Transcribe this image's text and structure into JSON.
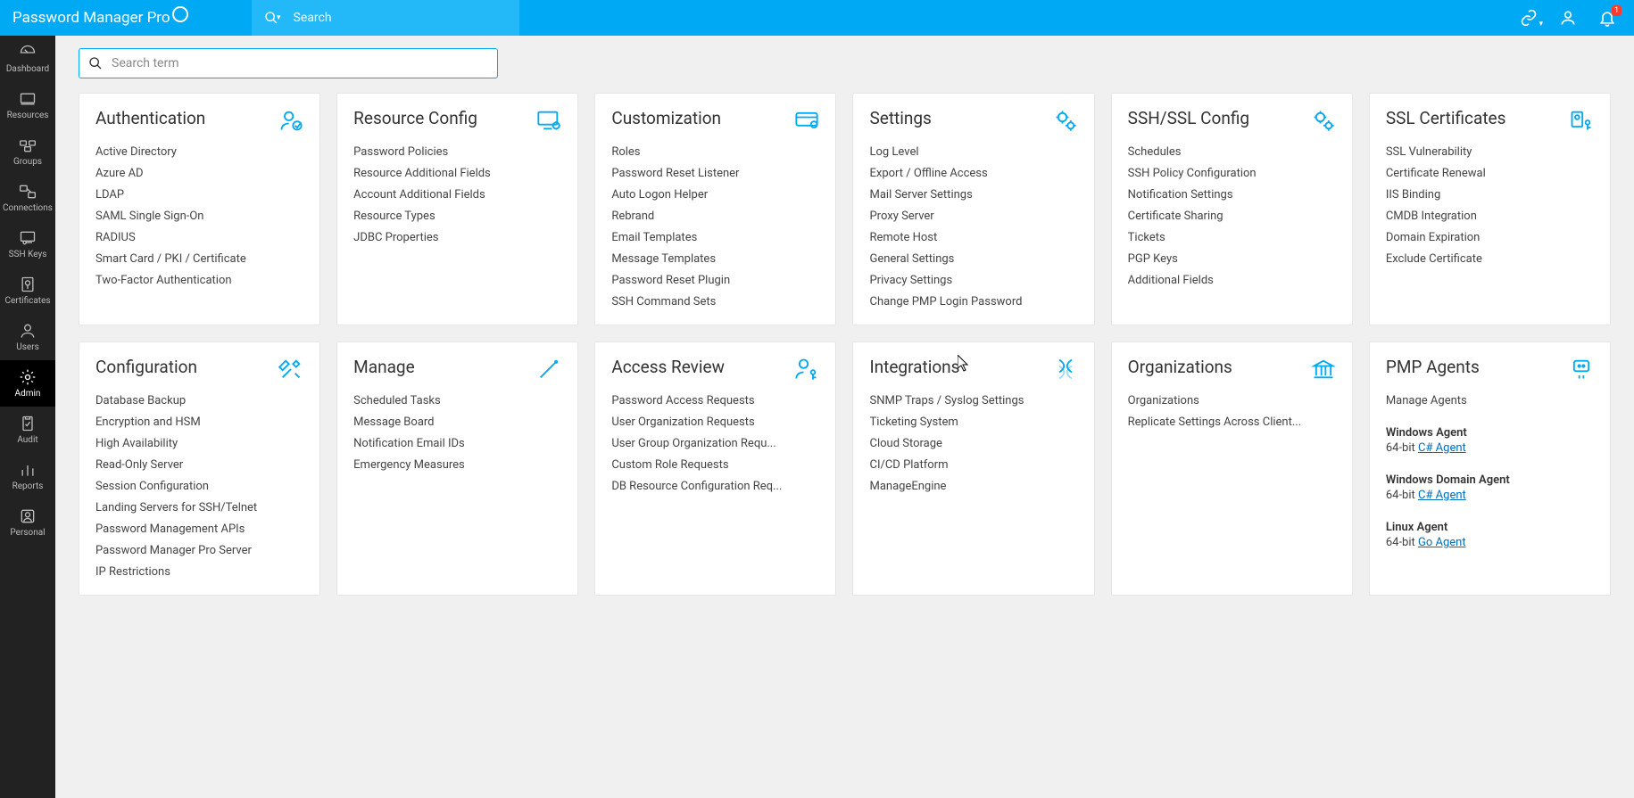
{
  "brand": "Password Manager Pro",
  "topsearch_placeholder": "Search",
  "filter_placeholder": "Search term",
  "notif_badge": "1",
  "sidebar": [
    {
      "id": "dashboard",
      "label": "Dashboard"
    },
    {
      "id": "resources",
      "label": "Resources"
    },
    {
      "id": "groups",
      "label": "Groups"
    },
    {
      "id": "connections",
      "label": "Connections"
    },
    {
      "id": "ssh-keys",
      "label": "SSH Keys"
    },
    {
      "id": "certificates",
      "label": "Certificates"
    },
    {
      "id": "users",
      "label": "Users"
    },
    {
      "id": "admin",
      "label": "Admin",
      "active": true
    },
    {
      "id": "audit",
      "label": "Audit"
    },
    {
      "id": "reports",
      "label": "Reports"
    },
    {
      "id": "personal",
      "label": "Personal"
    }
  ],
  "cards": [
    {
      "id": "authentication",
      "title": "Authentication",
      "icon": "user-check",
      "items": [
        "Active Directory",
        "Azure AD",
        "LDAP",
        "SAML Single Sign-On",
        "RADIUS",
        "Smart Card / PKI / Certificate",
        "Two-Factor Authentication"
      ]
    },
    {
      "id": "resource-config",
      "title": "Resource Config",
      "icon": "monitor-gear",
      "items": [
        "Password Policies",
        "Resource Additional Fields",
        "Account Additional Fields",
        "Resource Types",
        "JDBC Properties"
      ]
    },
    {
      "id": "customization",
      "title": "Customization",
      "icon": "card-gear",
      "items": [
        "Roles",
        "Password Reset Listener",
        "Auto Logon Helper",
        "Rebrand",
        "Email Templates",
        "Message Templates",
        "Password Reset Plugin",
        "SSH Command Sets"
      ]
    },
    {
      "id": "settings",
      "title": "Settings",
      "icon": "gears",
      "items": [
        "Log Level",
        "Export / Offline Access",
        "Mail Server Settings",
        "Proxy Server",
        "Remote Host",
        "General Settings",
        "Privacy Settings",
        "Change PMP Login Password"
      ]
    },
    {
      "id": "ssh-ssl-config",
      "title": "SSH/SSL Config",
      "icon": "gears",
      "items": [
        "Schedules",
        "SSH Policy Configuration",
        "Notification Settings",
        "Certificate Sharing",
        "Tickets",
        "PGP Keys",
        "Additional Fields"
      ]
    },
    {
      "id": "ssl-certificates",
      "title": "SSL Certificates",
      "icon": "cert-key",
      "items": [
        "SSL Vulnerability",
        "Certificate Renewal",
        "IIS Binding",
        "CMDB Integration",
        "Domain Expiration",
        "Exclude Certificate"
      ]
    },
    {
      "id": "configuration",
      "title": "Configuration",
      "icon": "tools",
      "items": [
        "Database Backup",
        "Encryption and HSM",
        "High Availability",
        "Read-Only Server",
        "Session Configuration",
        "Landing Servers for SSH/Telnet",
        "Password Management APIs",
        "Password Manager Pro Server",
        "IP Restrictions"
      ]
    },
    {
      "id": "manage",
      "title": "Manage",
      "icon": "wand",
      "items": [
        "Scheduled Tasks",
        "Message Board",
        "Notification Email IDs",
        "Emergency Measures"
      ]
    },
    {
      "id": "access-review",
      "title": "Access Review",
      "icon": "user-key",
      "items": [
        "Password Access Requests",
        "User Organization Requests",
        "User Group Organization Requ...",
        "Custom Role Requests",
        "DB Resource Configuration Req..."
      ]
    },
    {
      "id": "integrations",
      "title": "Integrations",
      "icon": "dna",
      "items": [
        "SNMP Traps / Syslog Settings",
        "Ticketing System",
        "Cloud Storage",
        "CI/CD Platform",
        "ManageEngine"
      ]
    },
    {
      "id": "organizations",
      "title": "Organizations",
      "icon": "bank",
      "items": [
        "Organizations",
        "Replicate Settings Across Client..."
      ]
    },
    {
      "id": "pmp-agents",
      "title": "PMP Agents",
      "icon": "agent",
      "agent_card": true,
      "first_link": "Manage Agents",
      "agents": [
        {
          "heading": "Windows Agent",
          "bits": "64-bit",
          "link": "C# Agent"
        },
        {
          "heading": "Windows Domain Agent",
          "bits": "64-bit",
          "link": "C# Agent"
        },
        {
          "heading": "Linux Agent",
          "bits": "64-bit",
          "link": "Go Agent"
        }
      ]
    }
  ]
}
